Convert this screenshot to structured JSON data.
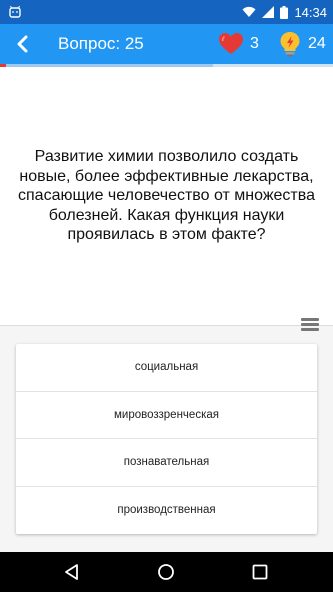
{
  "status_bar": {
    "time": "14:34",
    "icons": [
      "android-icon",
      "wifi-icon",
      "signal-icon",
      "battery-icon"
    ]
  },
  "app_bar": {
    "back_icon": "chevron-left-icon",
    "title": "Вопрос: 25",
    "lives": {
      "icon": "heart-icon",
      "count": "3"
    },
    "hints": {
      "icon": "lightbulb-icon",
      "count": "24"
    }
  },
  "progress": {
    "fraction": 0.64
  },
  "question": {
    "text": "Развитие химии позволило создать новые, более эффективные лекарства, спасающие человечество от множества болезней. Какая функция науки проявилась в этом факте?"
  },
  "menu": {
    "icon": "menu-icon"
  },
  "answers": [
    {
      "label": "социальная"
    },
    {
      "label": "мировоззренческая"
    },
    {
      "label": "познавательная"
    },
    {
      "label": "производственная"
    }
  ],
  "nav_bar": {
    "icons": [
      "back-triangle-icon",
      "home-circle-icon",
      "recents-square-icon"
    ]
  },
  "colors": {
    "status_bar": "#1565c0",
    "app_bar": "#2196f3",
    "heart": "#e53935",
    "lightbulb": "#fbc02d"
  }
}
